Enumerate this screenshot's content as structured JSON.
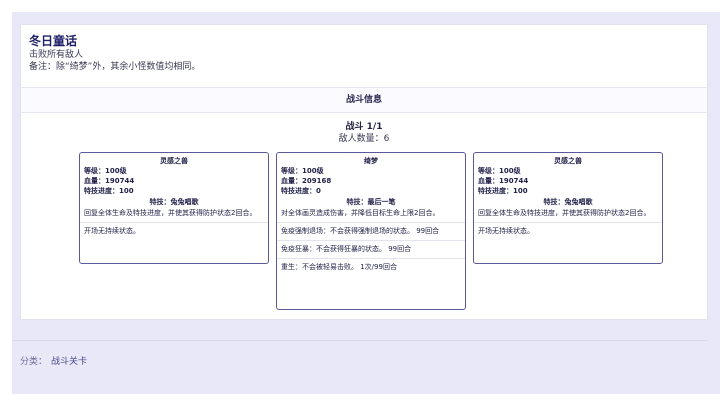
{
  "header": {
    "title": "冬日童话",
    "objective": "击败所有敌人",
    "note": "备注：除“绮梦”外，其余小怪数值均相同。"
  },
  "section": {
    "title": "战斗信息"
  },
  "battle": {
    "name": "战斗 1/1",
    "enemy_count": "敌人数量：6"
  },
  "enemies": [
    {
      "name": "灵感之兽",
      "level": "等级：100级",
      "hp": "血量：190744",
      "progress": "特技进度：100",
      "skill": "特技：兔兔唱歌",
      "skill_desc": "回复全体生命及特技进度，并使其获得防护状态2回合。",
      "passives": [
        "开场无持续状态。"
      ]
    },
    {
      "name": "绮梦",
      "level": "等级：100级",
      "hp": "血量：209168",
      "progress": "特技进度：0",
      "skill": "特技：最后一笔",
      "skill_desc": "对全体画灵造成伤害，并降低目标生命上限2回合。",
      "passives": [
        "免疫强制退场：不会获得强制退场的状态。 99回合",
        "免疫狂暴：不会获得狂暴的状态。 99回合",
        "重生：不会被轻易击败。 1次/99回合"
      ]
    },
    {
      "name": "灵感之兽",
      "level": "等级：100级",
      "hp": "血量：190744",
      "progress": "特技进度：100",
      "skill": "特技：兔兔唱歌",
      "skill_desc": "回复全体生命及特技进度，并使其获得防护状态2回合。",
      "passives": [
        "开场无持续状态。"
      ]
    }
  ],
  "footer": {
    "category_label": "分类：",
    "category_link": "战斗关卡"
  }
}
